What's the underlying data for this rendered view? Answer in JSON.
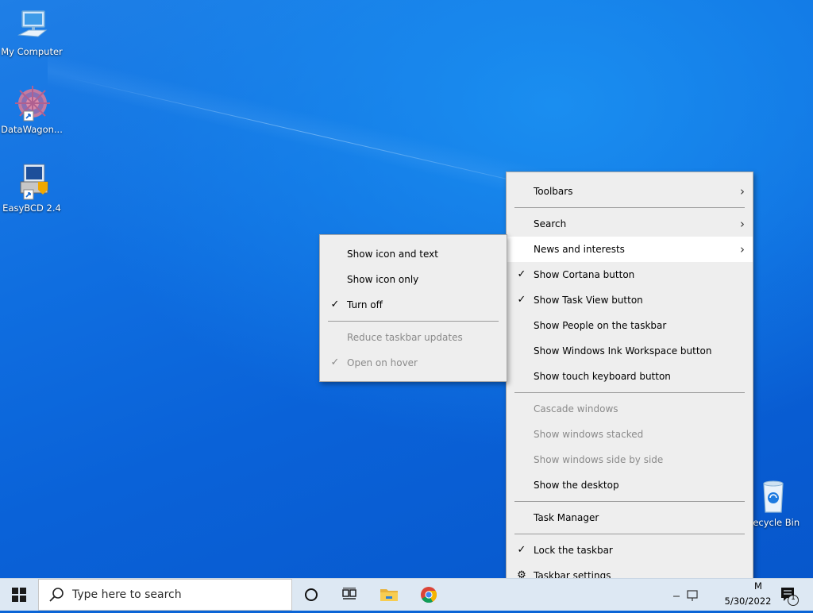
{
  "desktop": {
    "icons": [
      {
        "label": "My Computer"
      },
      {
        "label": "DataWagon..."
      },
      {
        "label": "EasyBCD 2.4"
      },
      {
        "label": "Recycle Bin"
      }
    ]
  },
  "context_menu": {
    "items": [
      {
        "label": "Toolbars",
        "submenu": true
      },
      {
        "label": "Search",
        "submenu": true
      },
      {
        "label": "News and interests",
        "submenu": true,
        "highlighted": true
      },
      {
        "label": "Show Cortana button",
        "checked": true
      },
      {
        "label": "Show Task View button",
        "checked": true
      },
      {
        "label": "Show People on the taskbar"
      },
      {
        "label": "Show Windows Ink Workspace button"
      },
      {
        "label": "Show touch keyboard button"
      },
      {
        "label": "Cascade windows",
        "disabled": true
      },
      {
        "label": "Show windows stacked",
        "disabled": true
      },
      {
        "label": "Show windows side by side",
        "disabled": true
      },
      {
        "label": "Show the desktop"
      },
      {
        "label": "Task Manager"
      },
      {
        "label": "Lock the taskbar",
        "checked": true
      },
      {
        "label": "Taskbar settings",
        "icon": "gear-icon"
      }
    ]
  },
  "news_submenu": {
    "items": [
      {
        "label": "Show icon and text"
      },
      {
        "label": "Show icon only"
      },
      {
        "label": "Turn off",
        "checked": true
      },
      {
        "label": "Reduce taskbar updates",
        "disabled": true
      },
      {
        "label": "Open on hover",
        "disabled": true,
        "checked": true
      }
    ]
  },
  "glyphs": {
    "check": "✓",
    "chevron": "›",
    "gear": "⚙",
    "notification_count": "1"
  },
  "taskbar": {
    "search_placeholder": "Type here to search",
    "pinned": [
      "cortana-icon",
      "task-view-icon",
      "file-explorer-icon",
      "chrome-icon"
    ],
    "clock_time_fragment": "M",
    "clock_date": "5/30/2022"
  },
  "colors": {
    "menu_bg": "#eeeeee",
    "menu_highlight": "#ffffff",
    "disabled_text": "#8a8a8a",
    "taskbar_bg": "#dde8f3",
    "desktop_blue": "#0a64d6"
  }
}
